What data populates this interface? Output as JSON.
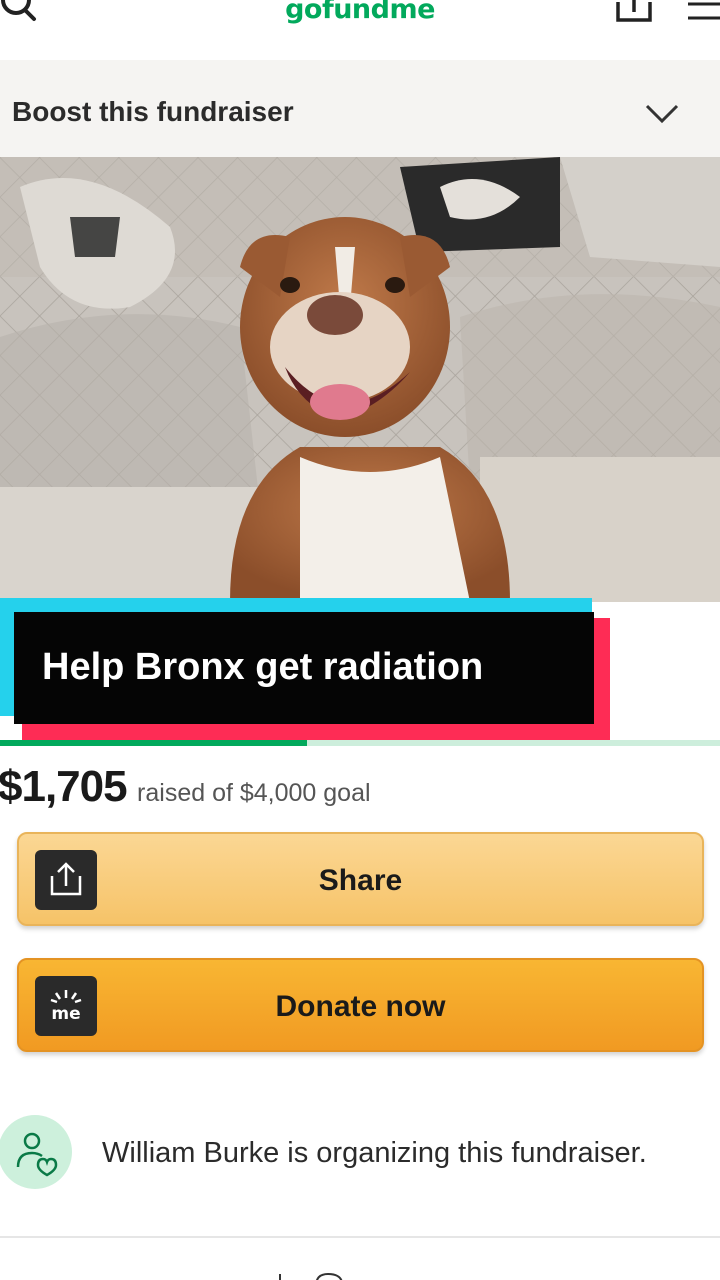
{
  "nav": {
    "logo": "gofundme",
    "icons": [
      "search-icon",
      "share-icon",
      "menu-icon"
    ]
  },
  "boost": {
    "label": "Boost this fundraiser",
    "icon": "chevron-down-icon"
  },
  "hero": {
    "image": "dog-photo"
  },
  "caption": {
    "text": "Help Bronx get radiation"
  },
  "progress": {
    "raised": "$1,705",
    "goal_text": "raised of $4,000 goal",
    "fraction": 0.426
  },
  "buttons": {
    "share_label": "Share",
    "donate_label": "Donate now",
    "donate_icon_text": "me"
  },
  "organizer": {
    "text": "William Burke is organizing this fundraiser."
  },
  "colors": {
    "brand_green": "#02a95c",
    "share_button": "#f6c368",
    "donate_button": "#f19a22",
    "caption_cyan": "#25d1ec",
    "caption_red": "#fe2c55"
  }
}
